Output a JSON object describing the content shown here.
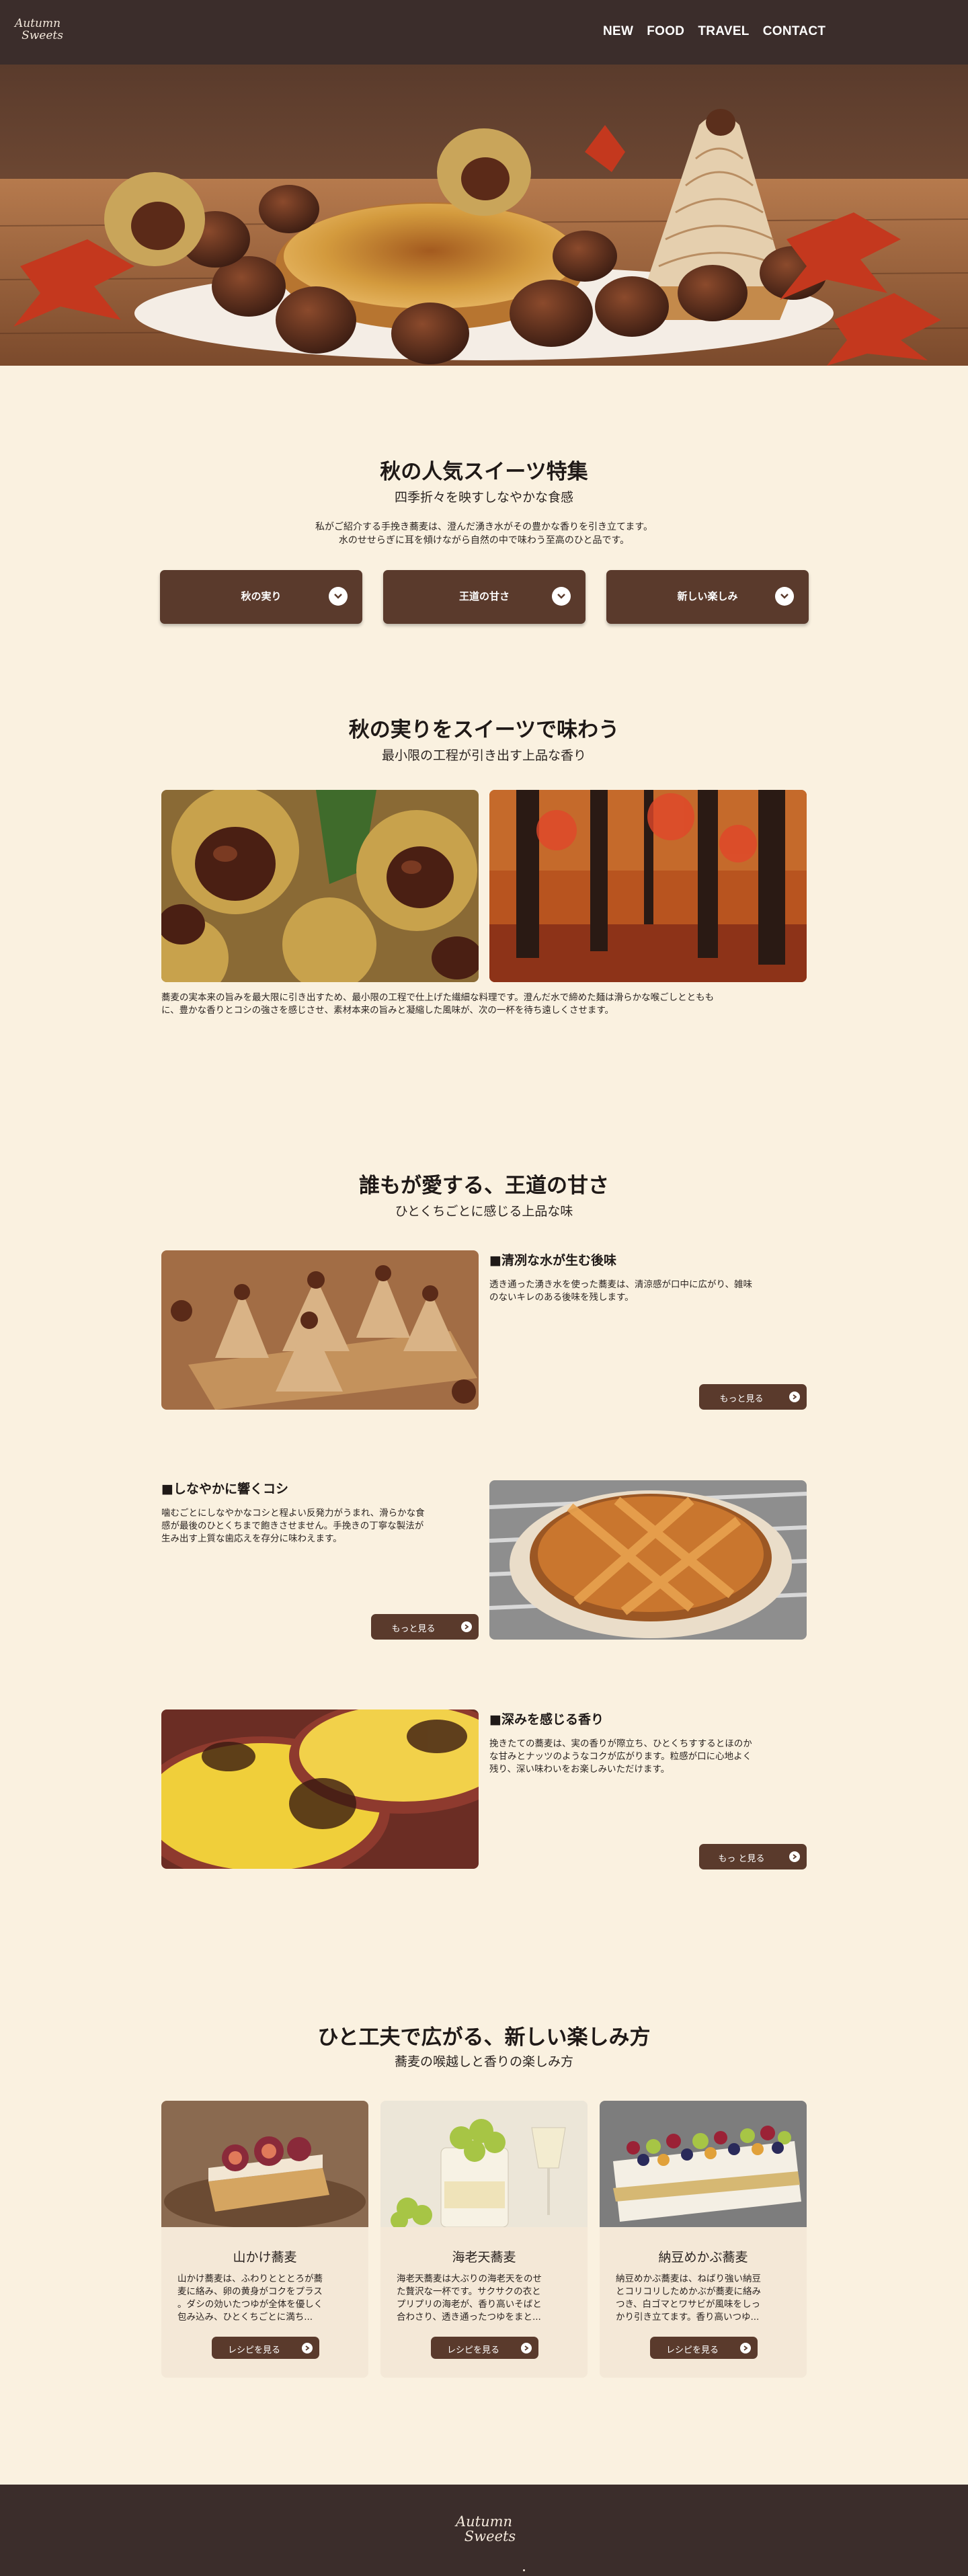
{
  "header": {
    "logo_line1": "Autumn",
    "logo_line2": "Sweets",
    "nav": [
      "NEW",
      "FOOD",
      "TRAVEL",
      "CONTACT"
    ]
  },
  "hero": {
    "image": "autumn-sweets-table-photo"
  },
  "feature": {
    "title": "秋の人気スイーツ特集",
    "subtitle": "四季折々を映すしなやかな食感",
    "intro_line1": "私がご紹介する手挽き蕎麦は、澄んだ湧き水がその豊かな香りを引き立てます。",
    "intro_line2": "水のせせらぎに耳を傾けながら自然の中で味わう至高のひと品です。",
    "buttons": [
      "秋の実り",
      "王道の甘さ",
      "新しい楽しみ"
    ]
  },
  "harvest": {
    "title": "秋の実りをスイーツで味わう",
    "subtitle": "最小限の工程が引き出す上品な香り",
    "body_line1": "蕎麦の実本来の旨みを最大限に引き出すため、最小限の工程で仕上げた繊細な料理です。澄んだ水で締めた麺は滑らかな喉ごしとともも",
    "body_line2": "に、豊かな香りとコシの強さを感じさせ、素材本来の旨みと凝縮した風味が、次の一杯を待ち遠しくさせます。"
  },
  "classics": {
    "title": "誰もが愛する、王道の甘さ",
    "subtitle": "ひとくちごとに感じる上品な味",
    "items": [
      {
        "heading": "■清冽な水が生む後味",
        "line1": "透き通った湧き水を使った蕎麦は、清涼感が口中に広がり、雑味",
        "line2": "のないキレのある後味を残します。",
        "line3": "",
        "button": "もっと見る"
      },
      {
        "heading": "■しなやかに響くコシ",
        "line1": "噛むごとにしなやかなコシと程よい反発力がうまれ、滑らかな食",
        "line2": "感が最後のひとくちまで飽きさせません。手挽きの丁寧な製法が",
        "line3": "生み出す上質な歯応えを存分に味わえます。",
        "button": "もっと見る"
      },
      {
        "heading": "■深みを感じる香り",
        "line1": "挽きたての蕎麦は、実の香りが際立ち、ひとくちすするとほのか",
        "line2": "な甘みとナッツのようなコクが広がります。粒感が口に心地よく",
        "line3": "残り、深い味わいをお楽しみいただけます。",
        "button": "もっ と見る"
      }
    ]
  },
  "newfun": {
    "title": "ひと工夫で広がる、新しい楽しみ方",
    "subtitle": "蕎麦の喉越しと香りの楽しみ方",
    "cards": [
      {
        "name": "山かけ蕎麦",
        "line1": "山かけ蕎麦は、ふわりとととろが蕎",
        "line2": "麦に絡み、卵の黄身がコクをプラス",
        "line3": "。ダシの効いたつゆが全体を優しく",
        "line4": "包み込み、ひとくちごとに満ち...",
        "button": "レシピを見る"
      },
      {
        "name": "海老天蕎麦",
        "line1": "海老天蕎麦は大ぶりの海老天をのせ",
        "line2": "た贅沢な一杯です。サクサクの衣と",
        "line3": "プリプリの海老が、香り高いそばと",
        "line4": "合わさり、透き通ったつゆをまと...",
        "button": "レシピを見る"
      },
      {
        "name": "納豆めかぶ蕎麦",
        "line1": "納豆めかぶ蕎麦は、ねばり強い納豆",
        "line2": "とコリコリしためかぶが蕎麦に絡み",
        "line3": "つき、白ゴマとワサビが風味をしっ",
        "line4": "かり引き立てます。香り高いつゆ...",
        "button": "レシピを見る"
      }
    ]
  },
  "footer": {
    "logo_line1": "Autumn",
    "logo_line2": "Sweets"
  }
}
